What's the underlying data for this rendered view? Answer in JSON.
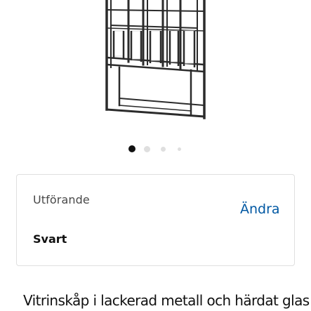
{
  "product": {
    "image_icon": "glass-door-cabinet-image",
    "title": "Vitrinskåp i lackerad metall och härdat glas"
  },
  "carousel": {
    "total_dots": 4,
    "active_index": 0
  },
  "option": {
    "label": "Utförande",
    "value": "Svart",
    "change_label": "Ändra"
  },
  "colors": {
    "accent": "#0058a3",
    "text_primary": "#111111",
    "text_secondary": "#484848",
    "border": "#dfdfdf"
  }
}
